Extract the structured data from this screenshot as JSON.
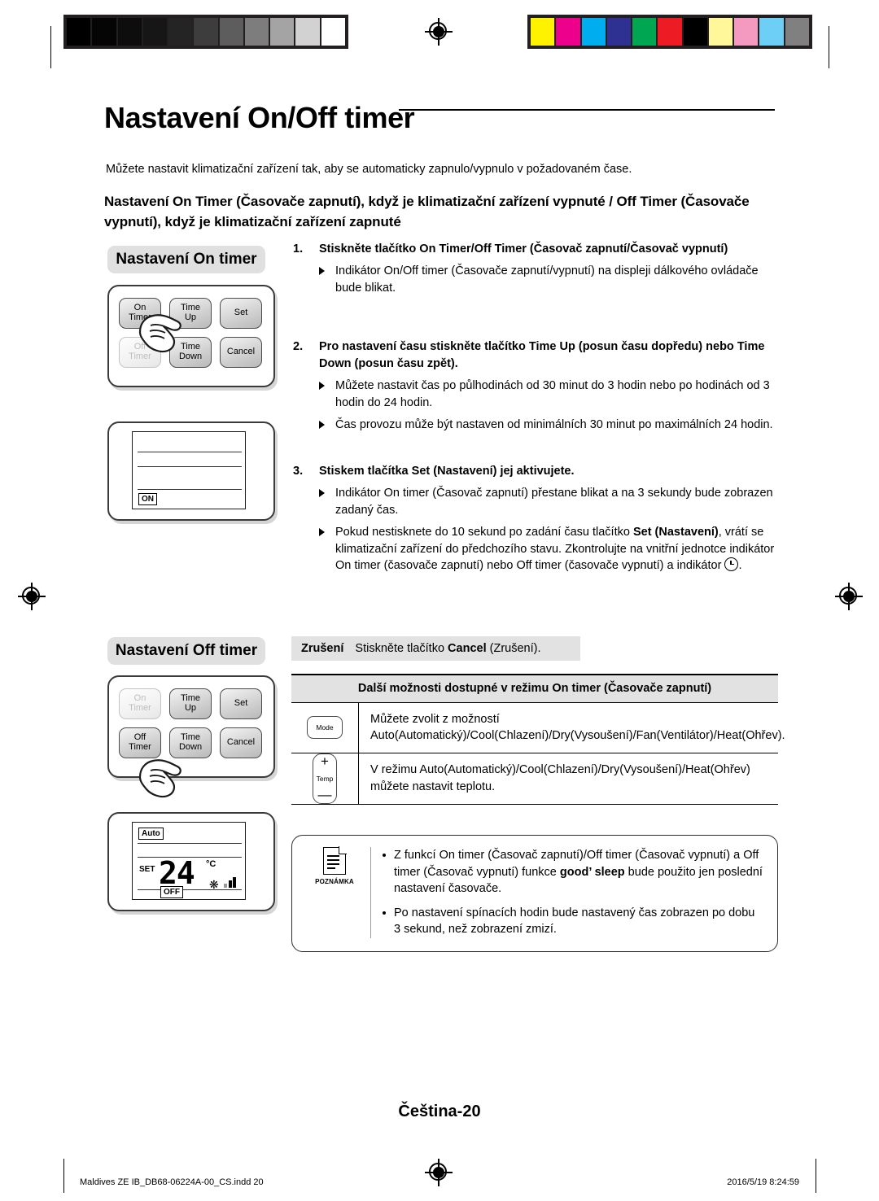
{
  "calibration": {
    "grayscale_swatches": [
      "#000000",
      "#050505",
      "#0d0d0d",
      "#161616",
      "#242424",
      "#3d3d3d",
      "#5d5d5d",
      "#7d7d7d",
      "#a4a4a4",
      "#d2d2d2",
      "#ffffff"
    ],
    "color_swatches": [
      "#fff200",
      "#ec008c",
      "#00aeef",
      "#2e3192",
      "#00a651",
      "#ed1c24",
      "#000000",
      "#fff799",
      "#f49ac1",
      "#6dcff6",
      "#808080"
    ]
  },
  "page": {
    "title": "Nastavení On/Off timer",
    "intro": "Můžete nastavit klimatizační zařízení tak, aby se automaticky zapnulo/vypnulo v požadovaném čase.",
    "subheading": "Nastavení On Timer (Časovače zapnutí), když je klimatizační zařízení vypnuté / Off Timer (Časovače vypnutí), když je klimatizační zařízení zapnuté",
    "page_label": "Čeština-20"
  },
  "illustrations": {
    "on_timer": {
      "caption": "Nastavení On timer",
      "keys": [
        {
          "label_line1": "On",
          "label_line2": "Timer",
          "state": "pressed"
        },
        {
          "label_line1": "Time",
          "label_line2": "Up",
          "state": "normal"
        },
        {
          "label_line1": "Set",
          "label_line2": "",
          "state": "normal"
        },
        {
          "label_line1": "Off",
          "label_line2": "Timer",
          "state": "disabled"
        },
        {
          "label_line1": "Time",
          "label_line2": "Down",
          "state": "normal"
        },
        {
          "label_line1": "Cancel",
          "label_line2": "",
          "state": "normal"
        }
      ],
      "display": {
        "indicator": "ON"
      }
    },
    "off_timer": {
      "caption": "Nastavení Off timer",
      "keys": [
        {
          "label_line1": "On",
          "label_line2": "Timer",
          "state": "disabled"
        },
        {
          "label_line1": "Time",
          "label_line2": "Up",
          "state": "normal"
        },
        {
          "label_line1": "Set",
          "label_line2": "",
          "state": "normal"
        },
        {
          "label_line1": "Off",
          "label_line2": "Timer",
          "state": "pressed"
        },
        {
          "label_line1": "Time",
          "label_line2": "Down",
          "state": "normal"
        },
        {
          "label_line1": "Cancel",
          "label_line2": "",
          "state": "normal"
        }
      ],
      "display": {
        "mode": "Auto",
        "set_label": "SET",
        "temperature": "24",
        "unit": "°C",
        "indicator": "OFF"
      }
    }
  },
  "steps": [
    {
      "number": "1.",
      "heading": "Stiskněte tlačítko On Timer/Off Timer (Časovač zapnutí/Časovač vypnutí)",
      "bullets": [
        "Indikátor On/Off timer (Časovače zapnutí/vypnutí) na displeji dálkového ovládače bude blikat."
      ]
    },
    {
      "number": "2.",
      "heading": "Pro nastavení času stiskněte tlačítko Time Up (posun času dopředu) nebo Time Down (posun času zpět).",
      "bullets": [
        "Můžete nastavit čas po půlhodinách od 30 minut do 3 hodin nebo po hodinách od 3 hodin do 24 hodin.",
        "Čas provozu může být nastaven od minimálních 30 minut po maximálních 24 hodin."
      ]
    },
    {
      "number": "3.",
      "heading": "Stiskem tlačítka Set (Nastavení) jej aktivujete.",
      "bullets": [
        "Indikátor On timer (Časovač zapnutí) přestane blikat a na 3 sekundy bude zobrazen zadaný čas.",
        "Pokud nestisknete do 10 sekund po zadání času tlačítko Set (Nastavení), vrátí se klimatizační zařízení do předchozího stavu. Zkontrolujte na vnitřní jednotce indikátor On timer (časovače zapnutí) nebo Off timer (časovače vypnutí) a indikátor ."
      ]
    }
  ],
  "cancel_row": {
    "label": "Zrušení",
    "text": "Stiskněte tlačítko Cancel (Zrušení)."
  },
  "options_table": {
    "header": "Další možnosti dostupné v režimu On timer (Časovače zapnutí)",
    "rows": [
      {
        "button_label": "Mode",
        "button_type": "mode",
        "text": "Můžete zvolit z možností Auto(Automatický)/Cool(Chlazení)/Dry(Vysoušení)/Fan(Ventilátor)/Heat(Ohřev)."
      },
      {
        "button_label": "Temp",
        "button_type": "temp",
        "plus": "+",
        "minus": "—",
        "text": "V režimu Auto(Automatický)/Cool(Chlazení)/Dry(Vysoušení)/Heat(Ohřev) můžete nastavit teplotu."
      }
    ]
  },
  "note": {
    "label": "POZNÁMKA",
    "items": [
      "Z funkcí On timer (Časovač zapnutí)/Off timer (Časovač vypnutí) a Off timer (Časovač vypnutí) funkce good’ sleep bude použito jen poslední nastavení časovače.",
      "Po nastavení spínacích hodin bude nastavený čas zobrazen po dobu 3 sekund, než zobrazení zmizí."
    ]
  },
  "footer": {
    "file": "Maldives ZE IB_DB68-06224A-00_CS.indd   20",
    "timestamp": "2016/5/19   8:24:59"
  }
}
